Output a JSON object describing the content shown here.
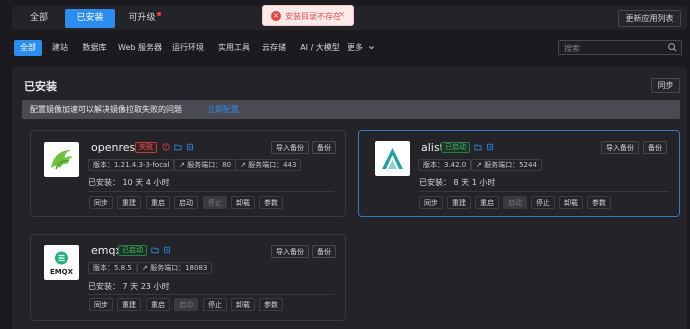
{
  "top_tabs": [
    {
      "label": "全部",
      "active": false
    },
    {
      "label": "已安装",
      "active": true
    },
    {
      "label": "可升级",
      "active": false,
      "has_dot": true
    }
  ],
  "refresh_label": "更新应用列表",
  "toast": {
    "icon": "error-circle-icon",
    "text": "安装目录不存在",
    "close": "×"
  },
  "categories": [
    "全部",
    "建站",
    "数据库",
    "Web 服务器",
    "运行环境",
    "实用工具",
    "云存储",
    "AI / 大模型",
    "更多"
  ],
  "search": {
    "placeholder": "搜索"
  },
  "panel": {
    "title": "已安装",
    "sync_label": "同步",
    "hint_text": "配置镜像加速可以解决镜像拉取失败的问题",
    "hint_link": "立即配置"
  },
  "version_prefix": "版本：",
  "port_label": "服务端口：",
  "apps": [
    {
      "name": "openresty",
      "status": "失败",
      "status_kind": "error",
      "version": "1.21.4.3-3-focal",
      "port_http": "80",
      "port_https": "443",
      "installed": "已安装：  10 天 4 小时",
      "buttons": [
        "导入备份",
        "备份"
      ],
      "actions": [
        {
          "label": "同步",
          "disabled": false
        },
        {
          "label": "重建",
          "disabled": false
        },
        {
          "label": "重启",
          "disabled": false
        },
        {
          "label": "启动",
          "disabled": false
        },
        {
          "label": "停止",
          "disabled": true
        },
        {
          "label": "卸载",
          "disabled": false
        },
        {
          "label": "参数",
          "disabled": false
        }
      ]
    },
    {
      "name": "alist",
      "status": "已启动",
      "status_kind": "ok",
      "version": "3.42.0",
      "port": "5244",
      "installed": "已安装：  8 天 1 小时",
      "buttons": [
        "导入备份",
        "备份"
      ],
      "actions": [
        {
          "label": "同步",
          "disabled": false
        },
        {
          "label": "重建",
          "disabled": false
        },
        {
          "label": "重启",
          "disabled": false
        },
        {
          "label": "启动",
          "disabled": true
        },
        {
          "label": "停止",
          "disabled": false
        },
        {
          "label": "卸载",
          "disabled": false
        },
        {
          "label": "参数",
          "disabled": false
        }
      ]
    },
    {
      "name": "emqx",
      "logo_text": "EMQX",
      "status": "已启动",
      "status_kind": "ok",
      "version": "5.8.5",
      "port": "18083",
      "installed": "已安装：  7 天 23 小时",
      "buttons": [
        "导入备份",
        "备份"
      ],
      "actions": [
        {
          "label": "同步",
          "disabled": false
        },
        {
          "label": "重建",
          "disabled": false
        },
        {
          "label": "重启",
          "disabled": false
        },
        {
          "label": "启动",
          "disabled": true
        },
        {
          "label": "停止",
          "disabled": false
        },
        {
          "label": "卸载",
          "disabled": false
        },
        {
          "label": "参数",
          "disabled": false
        }
      ]
    }
  ],
  "colors": {
    "accent": "#2d8cf0",
    "error": "#ec4242",
    "success": "#3fbe6b",
    "background": "#1b1b1f"
  }
}
